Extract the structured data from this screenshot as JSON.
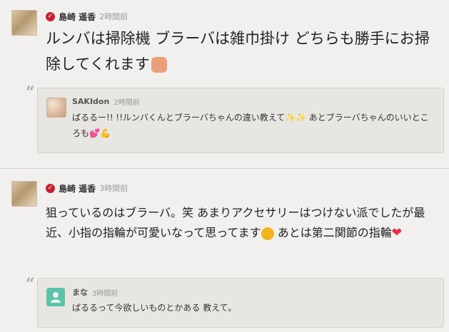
{
  "posts": [
    {
      "author": "島崎 遥香",
      "time": "2時間前",
      "text": "ルンバは掃除機 ブラーバは雑巾掛け どちらも勝手にお掃除してくれます",
      "emoji": "thumbs-up",
      "reply": {
        "author": "SAKIdon",
        "time": "2時間前",
        "text": "ぱるるー!! !!ルンバくんとブラーバちゃんの違い教えて✨✨ あとブラーバちゃんのいいところも💕💪"
      }
    },
    {
      "author": "島崎 遥香",
      "time": "3時間前",
      "text": "狙っているのはブラーバ。笑 あまりアクセサリーはつけない派でしたが最近、小指の指輪が可愛いなって思ってます",
      "text_tail": " あとは第二関節の指輪",
      "emoji": "relieved-face",
      "emoji2": "heart",
      "reply": {
        "author": "まな",
        "time": "3時間前",
        "text": "ぱるるって今欲しいものとかある 教えて。"
      }
    }
  ],
  "colors": {
    "verified": "#c8202e",
    "background": "#f1f0ee",
    "reply_bg": "#e8e6e2"
  },
  "icons": {
    "verified": "verified-check-icon",
    "quote": "quote-icon"
  },
  "quote_glyph": "“"
}
